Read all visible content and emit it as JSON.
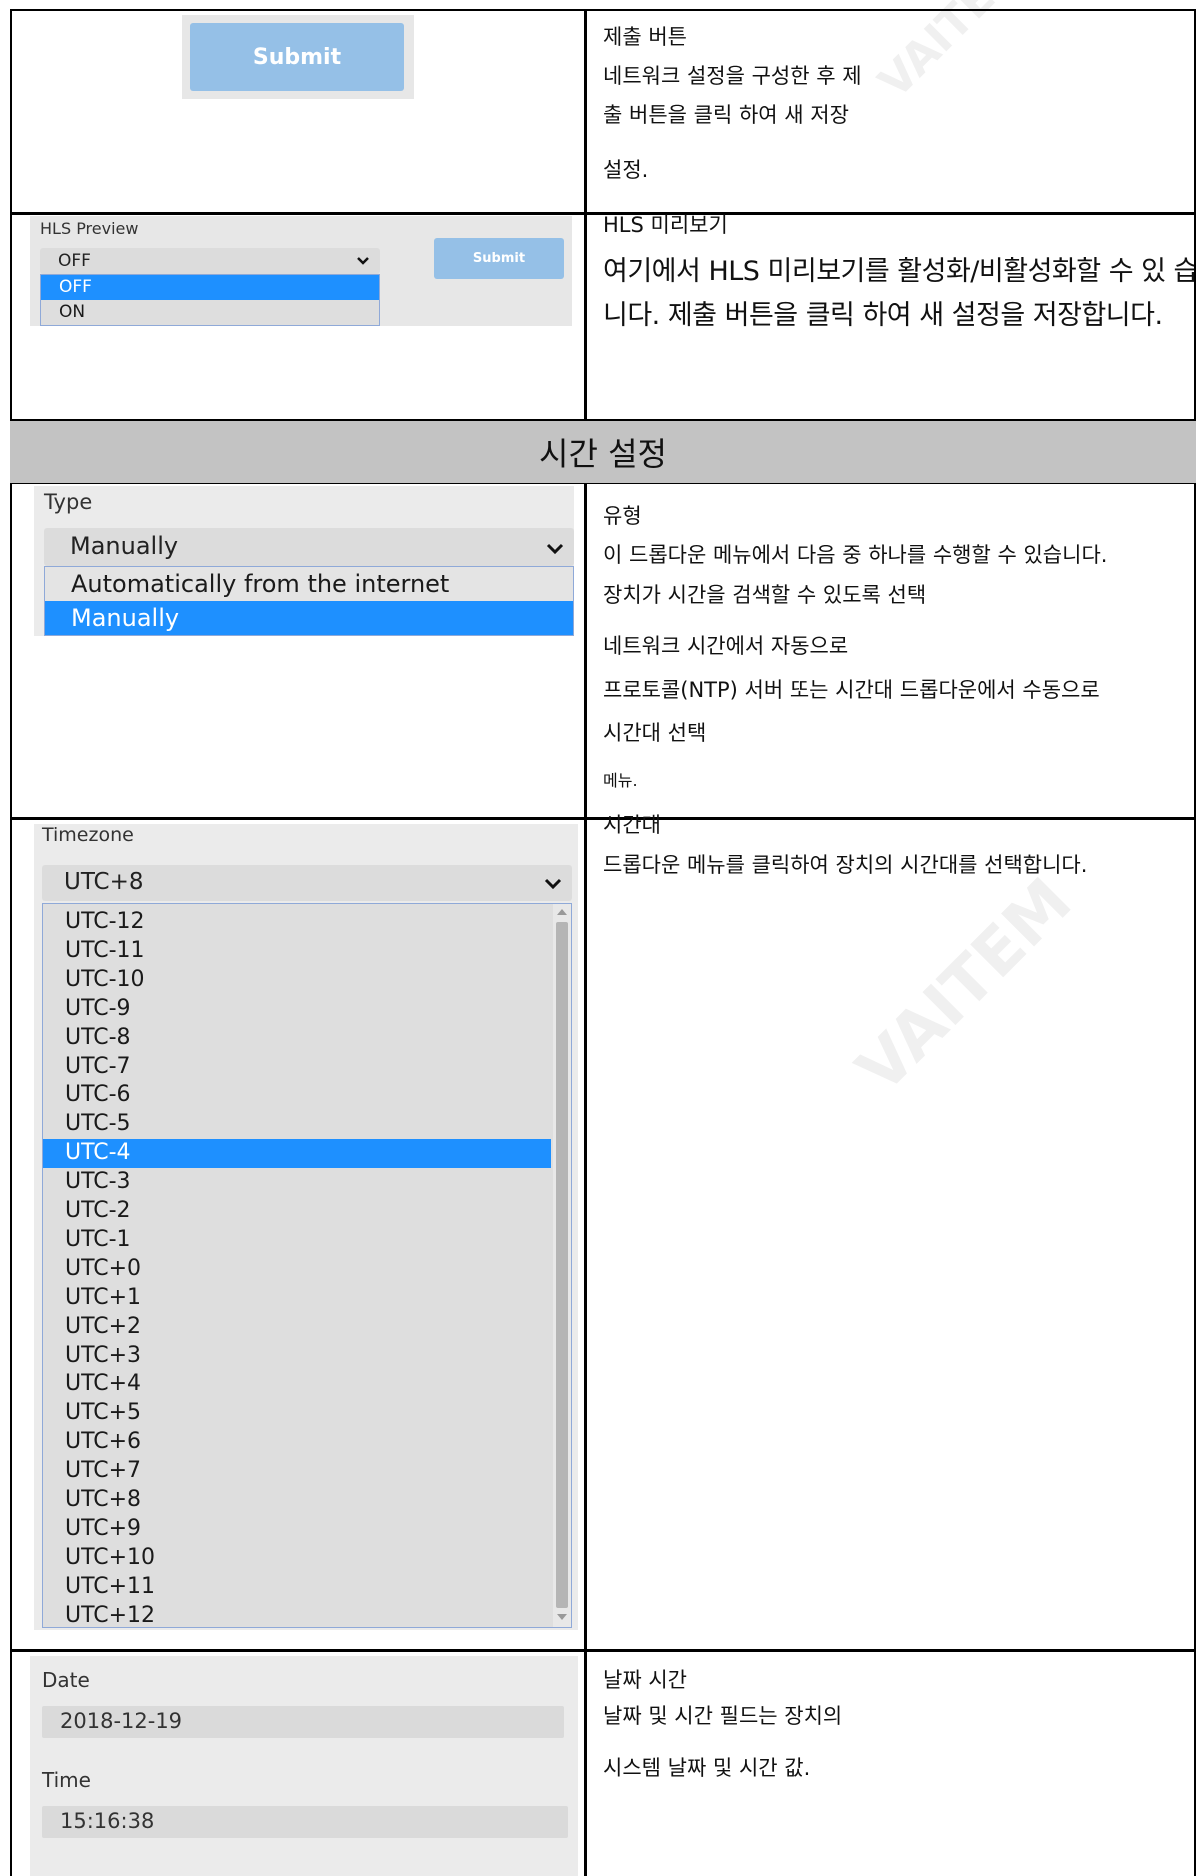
{
  "submit_row": {
    "button_label": "Submit",
    "desc": [
      "제출 버튼",
      "네트워크 설정을 구성한 후   제",
      "출 버튼을 클릭 하여 새 저장",
      "설정."
    ]
  },
  "hls_row": {
    "label": "HLS Preview",
    "selected": "OFF",
    "options": [
      "OFF",
      "ON"
    ],
    "selected_option_index": 0,
    "submit_label": "Submit",
    "desc_title": "HLS 미리보기",
    "desc": [
      "여기에서 HLS  미리보기를 활성화/비활성화할 수  있   습",
      "니다. 제출 버튼을 클릭 하여 새 설정을 저장합니다."
    ]
  },
  "section": {
    "title": "시간 설정"
  },
  "type_row": {
    "label": "Type",
    "selected": "Manually",
    "options": [
      "Automatically from the internet",
      "Manually"
    ],
    "selected_option_index": 1,
    "desc_title": "유형",
    "desc": [
      "이 드롭다운 메뉴에서 다음 중 하나를 수행할 수 있습니다.",
      "장치가 시간을 검색할 수 있도록 선택",
      "네트워크 시간에서 자동으로",
      "프로토콜(NTP) 서버 또는 시간대 드롭다운에서 수동으로",
      "시간대 선택",
      "메뉴."
    ]
  },
  "timezone_row": {
    "label": "Timezone",
    "selected": "UTC+8",
    "options": [
      "UTC-12",
      "UTC-11",
      "UTC-10",
      "UTC-9",
      "UTC-8",
      "UTC-7",
      "UTC-6",
      "UTC-5",
      "UTC-4",
      "UTC-3",
      "UTC-2",
      "UTC-1",
      "UTC+0",
      "UTC+1",
      "UTC+2",
      "UTC+3",
      "UTC+4",
      "UTC+5",
      "UTC+6",
      "UTC+7",
      "UTC+8",
      "UTC+9",
      "UTC+10",
      "UTC+11",
      "UTC+12"
    ],
    "highlighted_option_index": 8,
    "desc_title": "시간대",
    "desc": [
      "드롭다운 메뉴를 클릭하여 장치의 시간대를 선택합니다."
    ]
  },
  "datetime_row": {
    "date_label": "Date",
    "date_value": "2018-12-19",
    "time_label": "Time",
    "time_value": "15:16:38",
    "desc_title": "날짜 시간",
    "desc": [
      "날짜 및 시간 필드는 장치의",
      "시스템 날짜 및 시간 값."
    ]
  },
  "watermark": "VAITEM",
  "colors": {
    "accent": "#1e90ff",
    "button": "#95c0e7",
    "header_bg": "#c3c3c3",
    "panel": "#e7e7e7"
  }
}
